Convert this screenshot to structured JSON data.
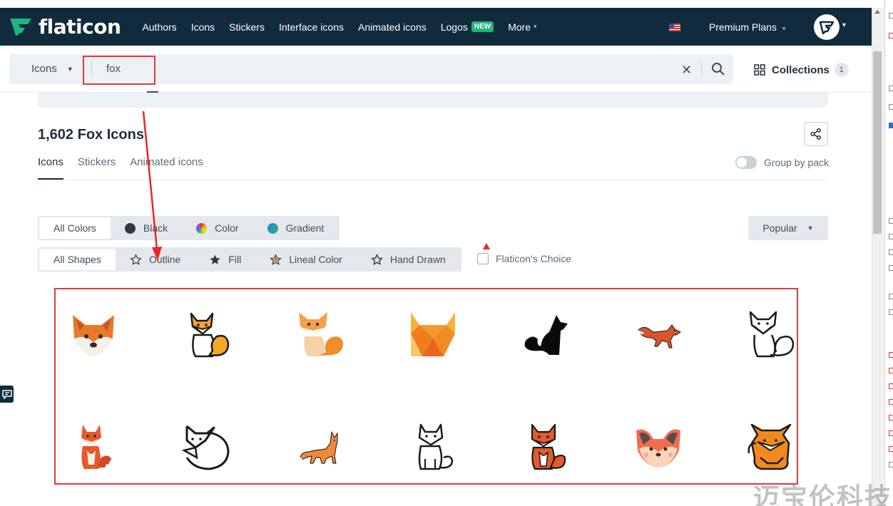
{
  "brand": {
    "name": "flaticon"
  },
  "nav": {
    "items": [
      {
        "label": "Authors"
      },
      {
        "label": "Icons"
      },
      {
        "label": "Stickers"
      },
      {
        "label": "Interface icons"
      },
      {
        "label": "Animated icons"
      },
      {
        "label": "Logos",
        "badge": "NEW"
      },
      {
        "label": "More"
      }
    ],
    "premium_label": "Premium Plans"
  },
  "search": {
    "type_label": "Icons",
    "query": "fox",
    "collections_label": "Collections",
    "collections_count": "1"
  },
  "results": {
    "title": "1,602 Fox Icons",
    "tabs": [
      {
        "label": "Icons",
        "active": true
      },
      {
        "label": "Stickers",
        "active": false
      },
      {
        "label": "Animated icons",
        "active": false
      }
    ],
    "group_by_pack_label": "Group by pack"
  },
  "filters": {
    "colors": [
      "All Colors",
      "Black",
      "Color",
      "Gradient"
    ],
    "shapes": [
      "All Shapes",
      "Outline",
      "Fill",
      "Lineal Color",
      "Hand Drawn"
    ],
    "sort_label": "Popular",
    "flaticon_choice_label": "Flaticon's Choice"
  },
  "icons": [
    {
      "name": "fox-face-flat-icon"
    },
    {
      "name": "sitting-fox-lineal-color-icon"
    },
    {
      "name": "sitting-fox-flat-icon"
    },
    {
      "name": "geometric-fox-icon"
    },
    {
      "name": "fox-silhouette-icon"
    },
    {
      "name": "running-fox-icon"
    },
    {
      "name": "sitting-fox-outline-icon"
    },
    {
      "name": "sitting-fox-red-icon"
    },
    {
      "name": "curled-fox-outline-icon"
    },
    {
      "name": "standing-fox-icon"
    },
    {
      "name": "fox-outline-sitting-icon"
    },
    {
      "name": "fox-cub-lineal-color-icon"
    },
    {
      "name": "fox-face-pink-icon"
    },
    {
      "name": "fox-hand-drawn-icon"
    }
  ],
  "watermark": "迈宝伦科技",
  "colors": {
    "topbar": "#0f2b3d",
    "accent_new": "#1fb57c",
    "annotation_red": "#e23b3b",
    "fox_orange": "#e9792a"
  }
}
